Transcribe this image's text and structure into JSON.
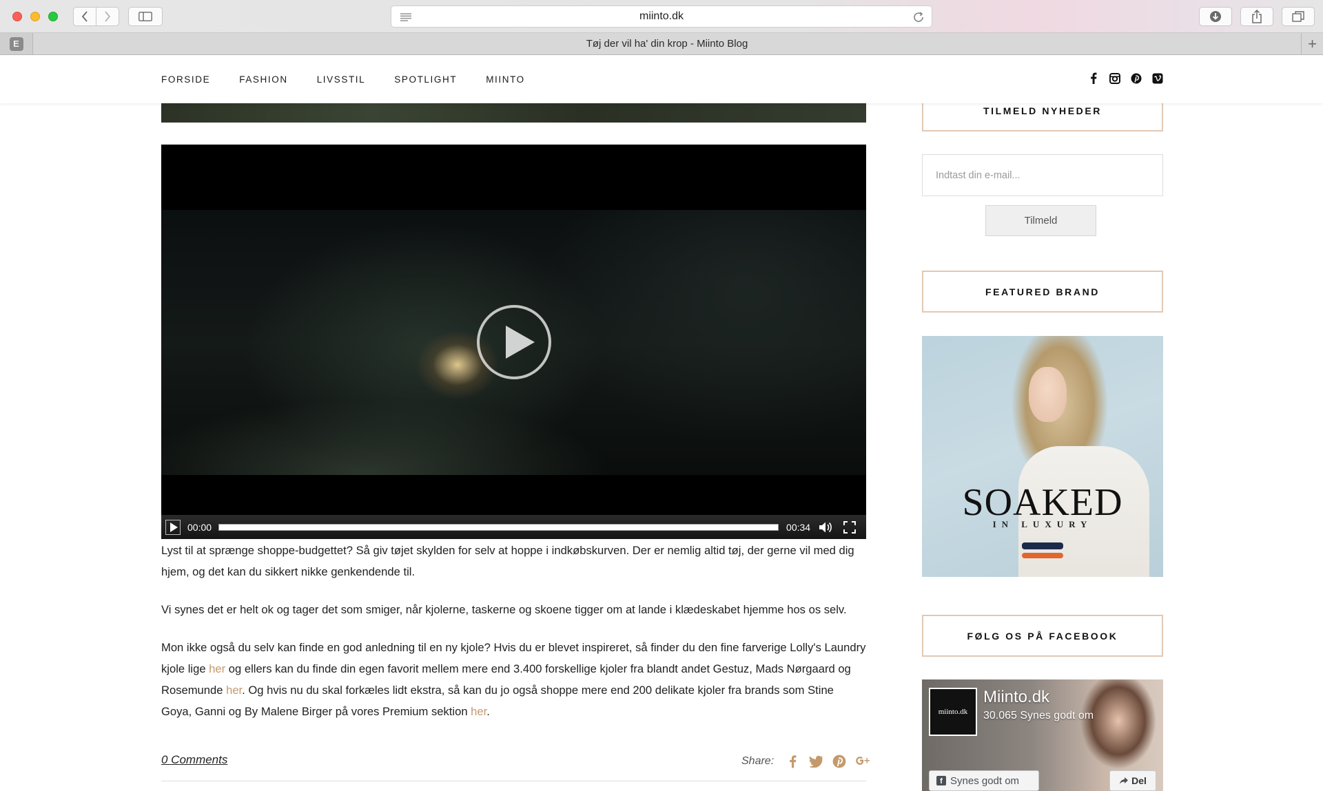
{
  "browser": {
    "url": "miinto.dk",
    "tab_title": "Tøj der vil ha' din krop - Miinto Blog",
    "pinned_tab_letter": "E",
    "new_tab_symbol": "+"
  },
  "nav": {
    "items": [
      {
        "label": "FORSIDE"
      },
      {
        "label": "FASHION"
      },
      {
        "label": "LIVSSTIL"
      },
      {
        "label": "SPOTLIGHT"
      },
      {
        "label": "MIINTO"
      }
    ],
    "social_icons": [
      "facebook-icon",
      "instagram-icon",
      "pinterest-icon",
      "vimeo-icon"
    ]
  },
  "video": {
    "current_time": "00:00",
    "duration": "00:34"
  },
  "article": {
    "p1": "Lyst til at sprænge shoppe-budgettet? Så giv tøjet skylden for selv at hoppe i indkøbskurven. Der er nemlig altid tøj, der gerne vil med dig hjem, og det kan du sikkert nikke genkendende til.",
    "p2": "Vi synes det er helt ok og tager det som smiger, når kjolerne, taskerne og skoene tigger om at lande i klædeskabet hjemme hos os selv.",
    "p3_a": "Mon ikke også du selv kan finde en god anledning til en ny kjole? Hvis du er blevet inspireret, så finder du den fine farverige Lolly's Laundry kjole lige ",
    "p3_link1": "her",
    "p3_b": " og ellers kan du finde din egen favorit mellem mere end 3.400 forskellige kjoler fra blandt andet Gestuz, Mads Nørgaard og Rosemunde ",
    "p3_link2": "her",
    "p3_c": ". Og hvis nu du skal forkæles lidt ekstra, så kan du jo også shoppe mere end 200 delikate kjoler fra brands som Stine Goya, Ganni og By Malene Birger på vores Premium sektion ",
    "p3_link3": "her",
    "p3_d": ".",
    "link_color": "#c49a6c",
    "comments_label": "0 Comments",
    "share_label": "Share:",
    "share_icons": [
      "facebook-icon",
      "twitter-icon",
      "pinterest-icon",
      "google-plus-icon"
    ]
  },
  "sidebar": {
    "newsletter_title": "TILMELD NYHEDER",
    "email_placeholder": "Indtast din e-mail...",
    "subscribe_label": "Tilmeld",
    "featured_title": "FEATURED BRAND",
    "brand_name": "SOAKED",
    "brand_tagline": "IN LUXURY",
    "facebook_title": "FØLG OS PÅ FACEBOOK",
    "fb_page_name": "Miinto.dk",
    "fb_logo_text": "miinto.dk",
    "fb_likes": "30.065 Synes godt om",
    "fb_like_button": "Synes godt om",
    "fb_share_button": "Del",
    "box_border_color": "#e1c8b4"
  }
}
